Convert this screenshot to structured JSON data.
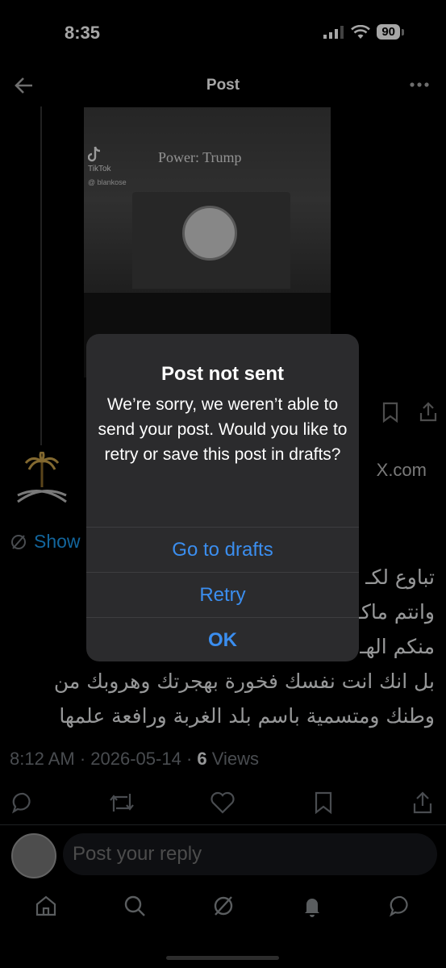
{
  "status_bar": {
    "time": "8:35",
    "battery": "90"
  },
  "nav": {
    "title": "Post"
  },
  "media": {
    "caption": "Power: Trump",
    "watermark": "TikTok",
    "watermark_handle": "@ blankose"
  },
  "link_domain": "X.com",
  "show_translation": "Show",
  "post": {
    "lines": [
      "تباوع لكـ",
      "وانتم ماكـ                                     الواحد",
      "منكم الهـ                                       عمة",
      "بل انك انت نفسك فخورة بهجرتك وهروبك من",
      "وطنك ومتسمية باسم بلد الغربة ورافعة علمها"
    ],
    "time": "8:12 AM",
    "date": "2026-05-14",
    "views_count": "6",
    "views_label": "Views"
  },
  "reply": {
    "placeholder": "Post your reply"
  },
  "alert": {
    "title": "Post not sent",
    "message": "We’re sorry, we weren’t able to send your post. Would you like to retry or save this post in drafts?",
    "buttons": {
      "drafts": "Go to drafts",
      "retry": "Retry",
      "ok": "OK"
    }
  },
  "colors": {
    "accent": "#1d9bf0",
    "alert_button": "#3b8eef",
    "background": "#000000"
  }
}
